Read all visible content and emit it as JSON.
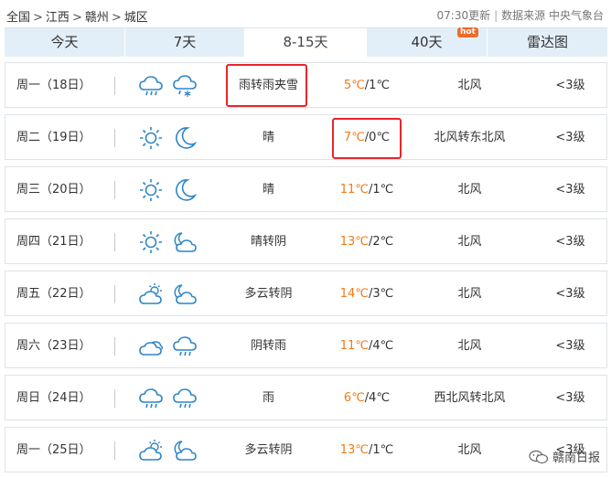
{
  "breadcrumb": {
    "items": [
      "全国",
      "江西",
      "赣州",
      "城区"
    ],
    "separator": ">"
  },
  "meta": {
    "updated": "07:30更新",
    "source": "数据来源 中央气象台"
  },
  "tabs": [
    {
      "label": "今天",
      "active": false
    },
    {
      "label": "7天",
      "active": false
    },
    {
      "label": "8-15天",
      "active": true
    },
    {
      "label": "40天",
      "active": false,
      "badge": "hot"
    },
    {
      "label": "雷达图",
      "active": false
    }
  ],
  "colors": {
    "tab_bg": "#e3eff8",
    "temp_high": "#f07a18",
    "highlight": "#e8262a",
    "icon": "#2f86c6",
    "sun": "#f5a623"
  },
  "forecast": [
    {
      "day": "周一（18日）",
      "icon_day": "cloud-rain-icon",
      "icon_night": "cloud-snow-icon",
      "desc": "雨转雨夹雪",
      "high": "5℃",
      "low": "/1℃",
      "wind": "北风",
      "level": "<3级"
    },
    {
      "day": "周二（19日）",
      "icon_day": "sun-icon",
      "icon_night": "moon-icon",
      "desc": "晴",
      "high": "7℃",
      "low": "/0℃",
      "wind": "北风转东北风",
      "level": "<3级"
    },
    {
      "day": "周三（20日）",
      "icon_day": "sun-icon",
      "icon_night": "moon-icon",
      "desc": "晴",
      "high": "11℃",
      "low": "/1℃",
      "wind": "北风",
      "level": "<3级"
    },
    {
      "day": "周四（21日）",
      "icon_day": "sun-icon",
      "icon_night": "moon-cloud-icon",
      "desc": "晴转阴",
      "high": "13℃",
      "low": "/2℃",
      "wind": "北风",
      "level": "<3级"
    },
    {
      "day": "周五（22日）",
      "icon_day": "sun-cloud-icon",
      "icon_night": "moon-cloud-icon",
      "desc": "多云转阴",
      "high": "14℃",
      "low": "/3℃",
      "wind": "北风",
      "level": "<3级"
    },
    {
      "day": "周六（23日）",
      "icon_day": "cloud-icon",
      "icon_night": "cloud-rain-icon",
      "desc": "阴转雨",
      "high": "11℃",
      "low": "/4℃",
      "wind": "北风",
      "level": "<3级"
    },
    {
      "day": "周日（24日）",
      "icon_day": "cloud-rain-icon",
      "icon_night": "cloud-rain-icon",
      "desc": "雨",
      "high": "6℃",
      "low": "/4℃",
      "wind": "西北风转北风",
      "level": "<3级"
    },
    {
      "day": "周一（25日）",
      "icon_day": "sun-cloud-icon",
      "icon_night": "moon-cloud-icon",
      "desc": "多云转阴",
      "high": "13℃",
      "low": "/1℃",
      "wind": "北风",
      "level": "<3级"
    }
  ],
  "watermark": {
    "text": "赣南日报"
  }
}
